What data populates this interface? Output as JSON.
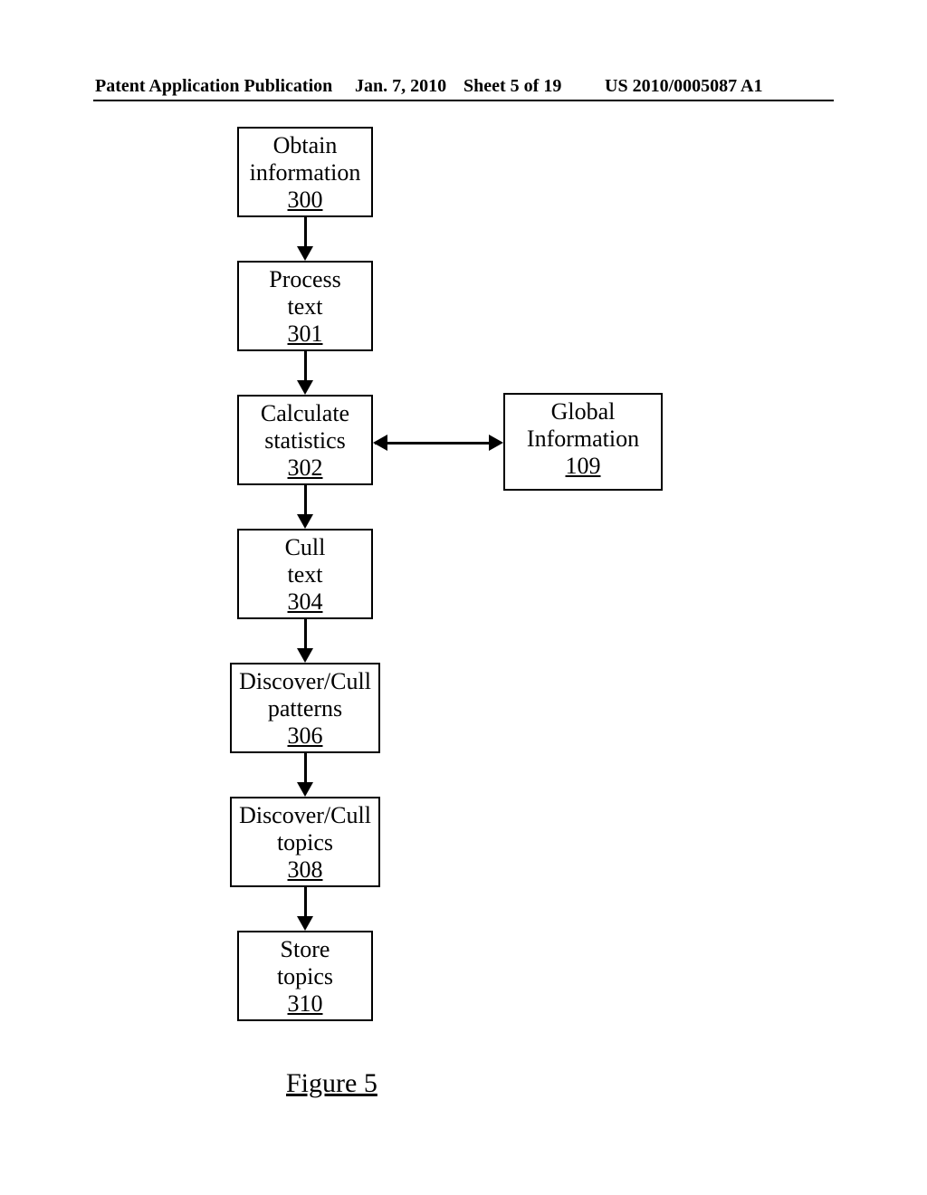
{
  "header": {
    "left": "Patent Application Publication",
    "date": "Jan. 7, 2010",
    "sheet": "Sheet 5 of 19",
    "pubno": "US 2010/0005087 A1"
  },
  "chart_data": {
    "type": "flowchart",
    "nodes": [
      {
        "id": "n300",
        "line1": "Obtain",
        "line2": "information",
        "ref": "300"
      },
      {
        "id": "n301",
        "line1": "Process",
        "line2": "text",
        "ref": "301"
      },
      {
        "id": "n302",
        "line1": "Calculate",
        "line2": "statistics",
        "ref": "302"
      },
      {
        "id": "n109",
        "line1": "Global",
        "line2": "Information",
        "ref": "109"
      },
      {
        "id": "n304",
        "line1": "Cull",
        "line2": "text",
        "ref": "304"
      },
      {
        "id": "n306",
        "line1": "Discover/Cull",
        "line2": "patterns",
        "ref": "306"
      },
      {
        "id": "n308",
        "line1": "Discover/Cull",
        "line2": "topics",
        "ref": "308"
      },
      {
        "id": "n310",
        "line1": "Store",
        "line2": "topics",
        "ref": "310"
      }
    ],
    "edges": [
      {
        "from": "n300",
        "to": "n301",
        "dir": "down"
      },
      {
        "from": "n301",
        "to": "n302",
        "dir": "down"
      },
      {
        "from": "n302",
        "to": "n109",
        "dir": "bi-horiz"
      },
      {
        "from": "n302",
        "to": "n304",
        "dir": "down"
      },
      {
        "from": "n304",
        "to": "n306",
        "dir": "down"
      },
      {
        "from": "n306",
        "to": "n308",
        "dir": "down"
      },
      {
        "from": "n308",
        "to": "n310",
        "dir": "down"
      }
    ],
    "caption": "Figure 5"
  }
}
